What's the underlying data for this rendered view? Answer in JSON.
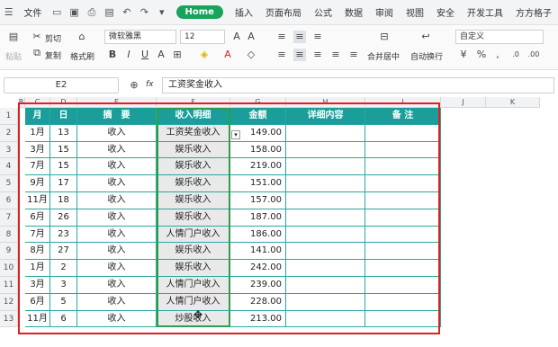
{
  "menubar": {
    "items": [
      "文件",
      "Home",
      "插入",
      "页面布局",
      "公式",
      "数据",
      "审阅",
      "视图",
      "安全",
      "开发工具",
      "方方格子"
    ]
  },
  "ribbon": {
    "cut": "剪切",
    "copy": "复制",
    "paste": "粘贴",
    "format_painter": "格式刷",
    "font_name": "微软雅黑",
    "font_size": "12",
    "merge": "合并居中",
    "wrap": "自动换行",
    "number_format": "自定义"
  },
  "formula": {
    "cell": "E2",
    "fx": "fx",
    "value": "工资奖金收入"
  },
  "columns": [
    "B",
    "C",
    "D",
    "E",
    "F",
    "G",
    "H",
    "I",
    "J",
    "K"
  ],
  "headers": [
    "月",
    "日",
    "摘　要",
    "收入明细",
    "金额",
    "详细内容",
    "备 注"
  ],
  "rows": [
    [
      "1月",
      "13",
      "收入",
      "工资奖金收入",
      "149.00"
    ],
    [
      "3月",
      "15",
      "收入",
      "娱乐收入",
      "158.00"
    ],
    [
      "7月",
      "15",
      "收入",
      "娱乐收入",
      "219.00"
    ],
    [
      "9月",
      "17",
      "收入",
      "娱乐收入",
      "151.00"
    ],
    [
      "11月",
      "18",
      "收入",
      "娱乐收入",
      "157.00"
    ],
    [
      "6月",
      "26",
      "收入",
      "娱乐收入",
      "187.00"
    ],
    [
      "7月",
      "23",
      "收入",
      "人情门户收入",
      "186.00"
    ],
    [
      "8月",
      "27",
      "收入",
      "娱乐收入",
      "141.00"
    ],
    [
      "1月",
      "2",
      "收入",
      "娱乐收入",
      "242.00"
    ],
    [
      "3月",
      "3",
      "收入",
      "人情门户收入",
      "239.00"
    ],
    [
      "6月",
      "5",
      "收入",
      "人情门户收入",
      "228.00"
    ],
    [
      "11月",
      "6",
      "收入",
      "炒股收入",
      "213.00"
    ]
  ],
  "row_numbers": [
    "1",
    "2",
    "3",
    "4",
    "5",
    "6",
    "7",
    "8",
    "9",
    "10",
    "11",
    "12",
    "13"
  ]
}
